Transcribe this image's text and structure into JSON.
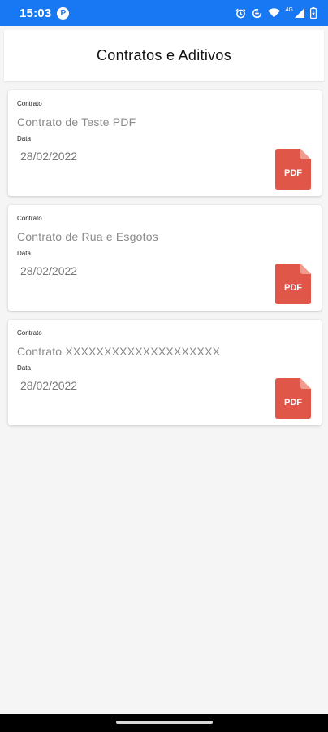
{
  "status_bar": {
    "time": "15:03",
    "app_badge": "P",
    "network": "4G"
  },
  "header": {
    "title": "Contratos e Aditivos"
  },
  "cards": [
    {
      "contract_label": "Contrato",
      "contract_name": "Contrato de Teste PDF",
      "date_label": "Data",
      "date": "28/02/2022",
      "pdf_label": "PDF"
    },
    {
      "contract_label": "Contrato",
      "contract_name": "Contrato de Rua e Esgotos",
      "date_label": "Data",
      "date": "28/02/2022",
      "pdf_label": "PDF"
    },
    {
      "contract_label": "Contrato",
      "contract_name": "Contrato XXXXXXXXXXXXXXXXXXXX",
      "date_label": "Data",
      "date": "28/02/2022",
      "pdf_label": "PDF"
    }
  ],
  "colors": {
    "status_bar": "#1877f2",
    "pdf_icon": "#e0574a",
    "background": "#f5f5f5"
  }
}
